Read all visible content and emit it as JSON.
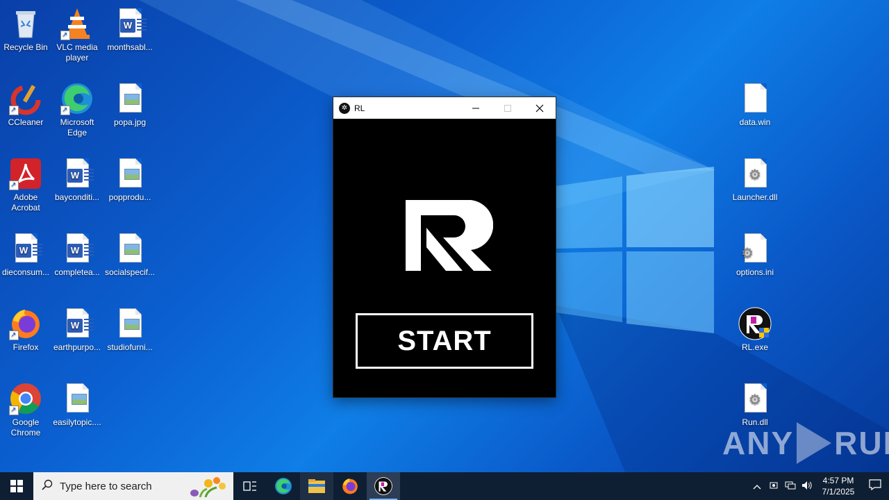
{
  "desktop": {
    "left_icons": [
      {
        "name": "recycle-bin",
        "label": "Recycle Bin"
      },
      {
        "name": "vlc",
        "label": "VLC media player"
      },
      {
        "name": "word-doc-1",
        "label": "monthsabl..."
      },
      {
        "name": "ccleaner",
        "label": "CCleaner"
      },
      {
        "name": "edge",
        "label": "Microsoft Edge"
      },
      {
        "name": "image-1",
        "label": "popa.jpg"
      },
      {
        "name": "acrobat",
        "label": "Adobe Acrobat"
      },
      {
        "name": "word-doc-2",
        "label": "bayconditi..."
      },
      {
        "name": "image-2",
        "label": "popprodu..."
      },
      {
        "name": "word-doc-3",
        "label": "dieconsum..."
      },
      {
        "name": "word-doc-4",
        "label": "completea..."
      },
      {
        "name": "image-3",
        "label": "socialspecif..."
      },
      {
        "name": "firefox",
        "label": "Firefox"
      },
      {
        "name": "word-doc-5",
        "label": "earthpurpo..."
      },
      {
        "name": "image-4",
        "label": "studiofurni..."
      },
      {
        "name": "chrome",
        "label": "Google Chrome"
      },
      {
        "name": "image-5",
        "label": "easilytopic...."
      }
    ],
    "right_icons": [
      {
        "name": "data-win",
        "label": "data.win"
      },
      {
        "name": "launcher-dll",
        "label": "Launcher.dll"
      },
      {
        "name": "options-ini",
        "label": "options.ini"
      },
      {
        "name": "rl-exe",
        "label": "RL.exe"
      },
      {
        "name": "run-dll",
        "label": "Run.dll"
      }
    ]
  },
  "app_window": {
    "title": "RL",
    "start_label": "START"
  },
  "watermark": {
    "left": "ANY",
    "right": "RUN"
  },
  "taskbar": {
    "search_placeholder": "Type here to search",
    "time": "4:57 PM",
    "date": "7/1/2025"
  },
  "colors": {
    "desktop_blue": "#0b5fd0",
    "taskbar": "#0f1f33",
    "app_bg": "#000000"
  }
}
